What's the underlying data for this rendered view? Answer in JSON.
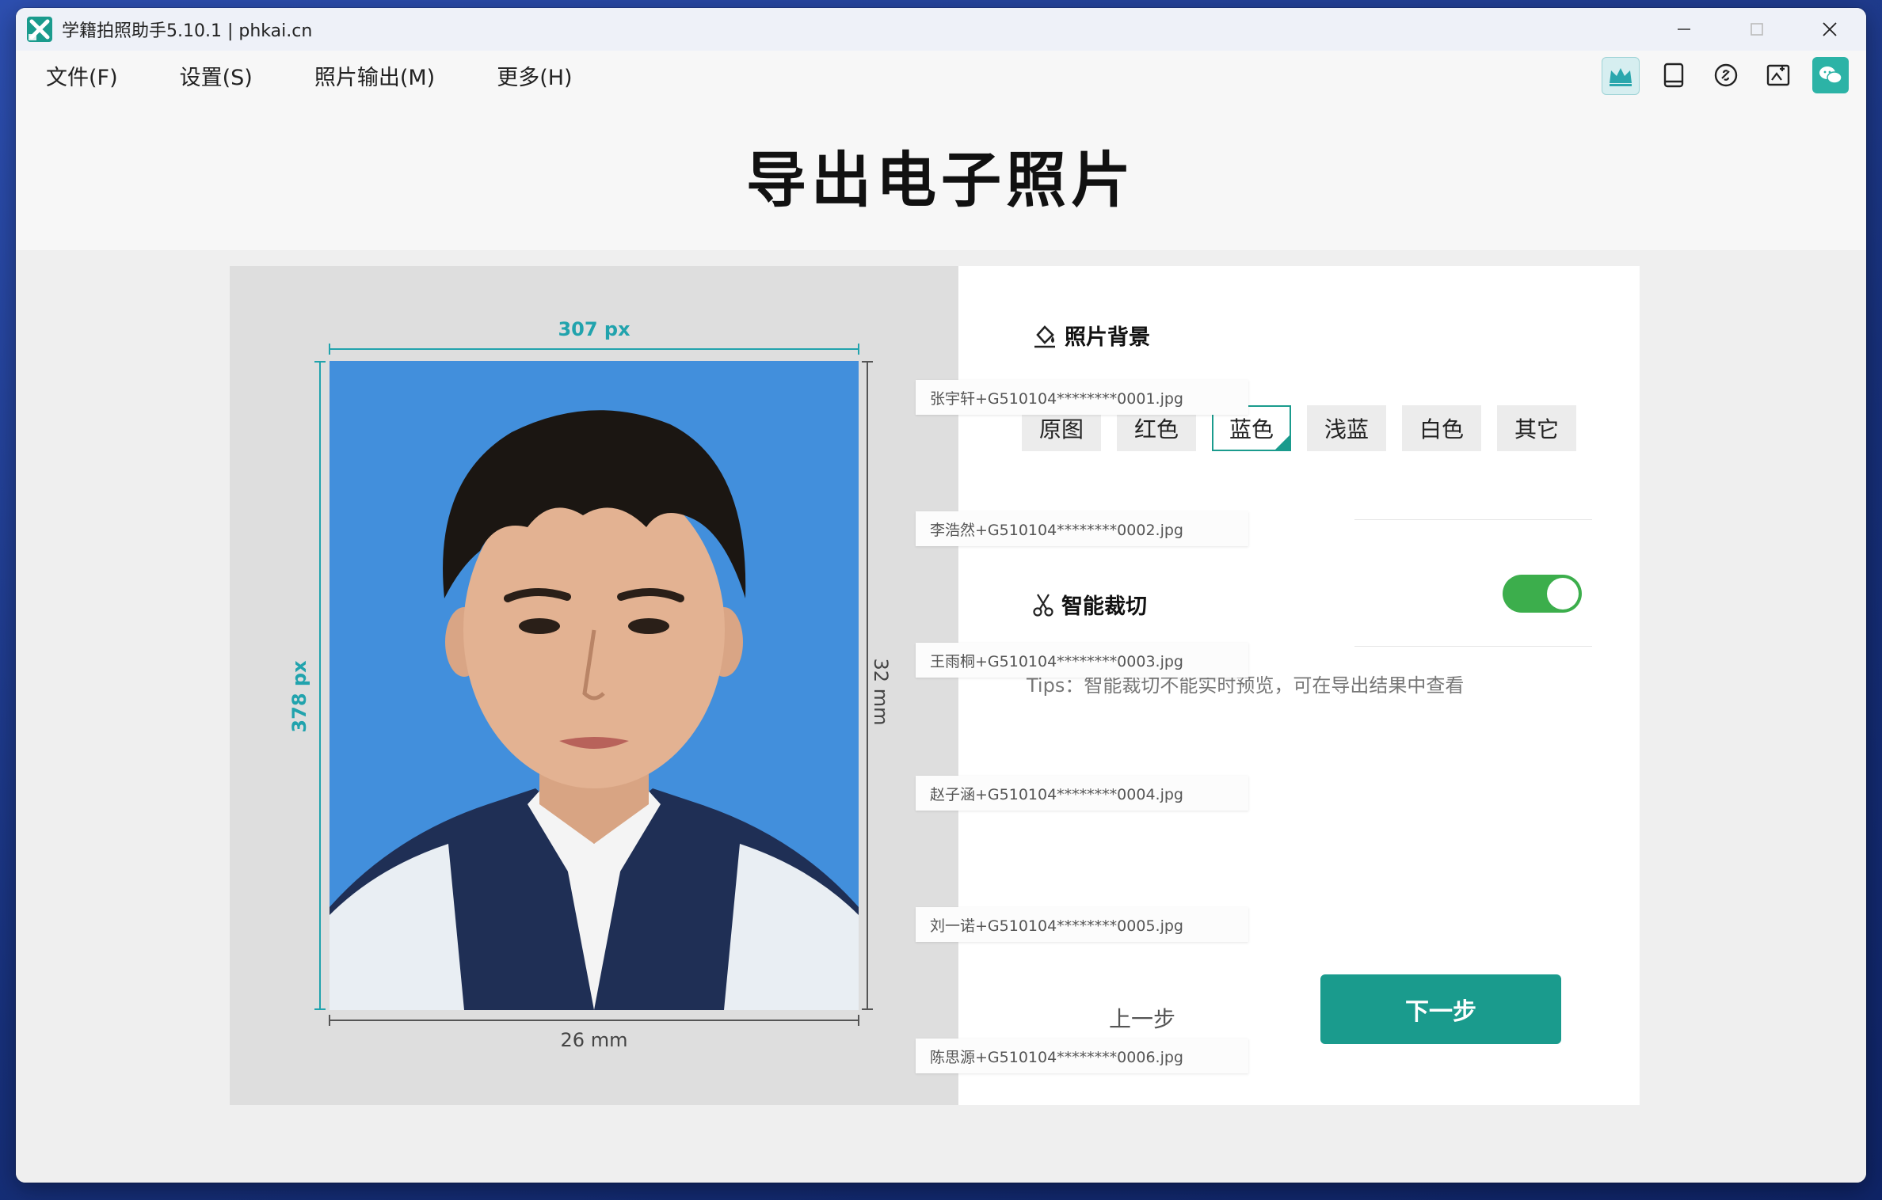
{
  "window": {
    "title": "学籍拍照助手5.10.1 | phkai.cn",
    "controls": {
      "minimize": "—",
      "maximize": "☐",
      "close": "✕"
    }
  },
  "menu": {
    "items": [
      "文件(F)",
      "设置(S)",
      "照片输出(M)",
      "更多(H)"
    ]
  },
  "toolbar": {
    "icons": [
      "crown-icon",
      "tablet-icon",
      "link-icon",
      "image-edit-icon",
      "wechat-icon"
    ]
  },
  "page": {
    "title": "导出电子照片"
  },
  "preview": {
    "width_px": "307 px",
    "height_px": "378 px",
    "width_mm": "26 mm",
    "height_mm": "32 mm",
    "background_color": "#428fdc"
  },
  "settings": {
    "background_section": {
      "title": "照片背景",
      "options": [
        "原图",
        "红色",
        "蓝色",
        "浅蓝",
        "白色",
        "其它"
      ],
      "selected": "蓝色"
    },
    "smart_crop": {
      "title": "智能裁切",
      "enabled": true,
      "tips": "Tips：智能裁切不能实时预览，可在导出结果中查看"
    }
  },
  "navigation": {
    "prev": "上一步",
    "next": "下一步"
  },
  "file_list": [
    "张宇轩+G510104********0001.jpg",
    "李浩然+G510104********0002.jpg",
    "王雨桐+G510104********0003.jpg",
    "赵子涵+G510104********0004.jpg",
    "刘一诺+G510104********0005.jpg",
    "陈思源+G510104********0006.jpg"
  ],
  "colors": {
    "accent": "#1a9b8d",
    "dimension": "#21a3ad",
    "toggle_on": "#3cae4c"
  }
}
